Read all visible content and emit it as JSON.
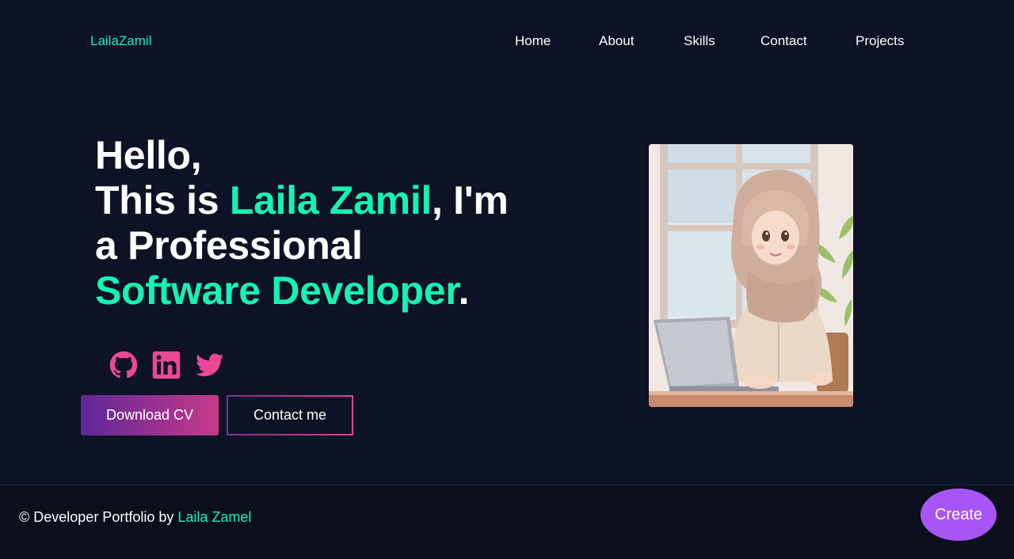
{
  "header": {
    "logo": "LailaZamil",
    "nav": [
      "Home",
      "About",
      "Skills",
      "Contact",
      "Projects"
    ]
  },
  "hero": {
    "line1": "Hello,",
    "line2_pre": "This is ",
    "line2_name": "Laila Zamil",
    "line2_post": ", I'm",
    "line3": "a Professional",
    "line4_role": "Software Developer",
    "line4_dot": "."
  },
  "social": {
    "icons": [
      "github-icon",
      "linkedin-icon",
      "twitter-icon"
    ],
    "color": "#ec4899"
  },
  "buttons": {
    "download_cv": "Download CV",
    "contact_me": "Contact me"
  },
  "footer": {
    "prefix": "© Developer Portfolio by ",
    "author": "Laila Zamel"
  },
  "floating": {
    "create": "Create"
  },
  "colors": {
    "background": "#0d1224",
    "accent": "#16f2b3",
    "gradient_start": "#5f2799",
    "gradient_end": "#c53a8a",
    "create_button": "#a855f7"
  }
}
